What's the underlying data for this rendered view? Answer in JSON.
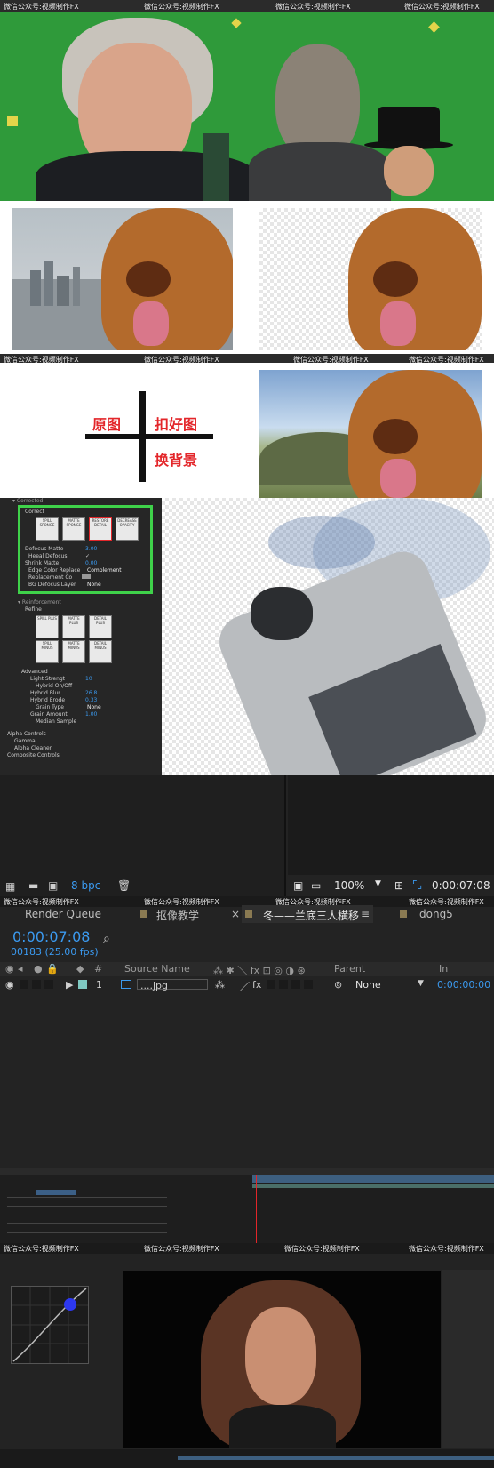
{
  "watermark": "微信公众号:视频制作FX",
  "panel3": {
    "left_top": "原图",
    "right_top": "扣好图",
    "right_bottom": "换背景"
  },
  "keylight": {
    "section_correct": "Correct",
    "buttons_correct": [
      "SPILL SPONGE",
      "MATTE SPONGE",
      "RESTORE DETAIL",
      "DECREASE OPACITY"
    ],
    "rows": [
      {
        "label": "Defocus Matte",
        "value": "3.00"
      },
      {
        "label": "Heeal Defocus",
        "value": "✓"
      },
      {
        "label": "Shrink Matte",
        "value": "0.00"
      },
      {
        "label": "Edge Color Replace",
        "value": "Complement"
      },
      {
        "label": "Replacement Co",
        "value": ""
      },
      {
        "label": "BG Defocus Layer",
        "value": "None"
      }
    ],
    "section_refine": "Refine",
    "buttons_refine": [
      "SPILL PLUS",
      "MATTE PLUS",
      "DETAIL PLUS",
      "SPILL MINUS",
      "MATTE MINUS",
      "DETAIL MINUS"
    ],
    "section_advanced": "Advanced",
    "adv_rows": [
      {
        "label": "Light Strengt",
        "value": "10"
      },
      {
        "label": "Hybrid On/Off",
        "value": ""
      },
      {
        "label": "Hybrid Blur",
        "value": "26.8"
      },
      {
        "label": "Hybrid Erode",
        "value": "0.33"
      },
      {
        "label": "Grain Type",
        "value": "None"
      },
      {
        "label": "Grain Amount",
        "value": "1.00"
      },
      {
        "label": "Median Sample",
        "value": ""
      }
    ],
    "alpha_controls": "Alpha Controls",
    "gamma": "Gamma",
    "alpha_cleaner": "Alpha Cleaner",
    "composite_controls": "Composite Controls"
  },
  "project_bar": {
    "bpc": "8 bpc"
  },
  "viewer_bar": {
    "zoom": "100%",
    "timecode": "0:00:07:08"
  },
  "tabs": [
    {
      "label": "Render Queue"
    },
    {
      "label": "抠像教学"
    },
    {
      "label": "冬——兰底三人横移",
      "active": true
    },
    {
      "label": "dong5"
    }
  ],
  "timeline": {
    "timecode": "0:00:07:08",
    "frame_info": "00183 (25.00 fps)",
    "headers": {
      "hash": "#",
      "source_name": "Source Name",
      "parent": "Parent",
      "in": "In"
    },
    "layer": {
      "num": "1",
      "name": "....jpg",
      "parent": "None",
      "in": "0:00:00:00"
    }
  },
  "colors": {
    "green_screen": "#2f9a3a",
    "ae_bg": "#232323",
    "ae_blue": "#3b9af0",
    "highlight_green": "#3fd24a",
    "accent_red": "#e3262a"
  }
}
